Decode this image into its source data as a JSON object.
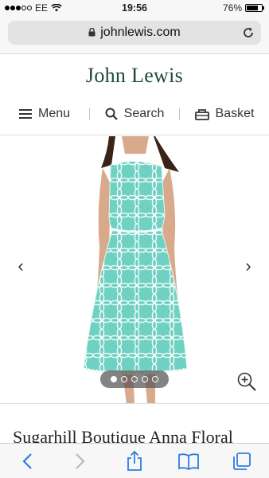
{
  "status_bar": {
    "carrier": "EE",
    "time": "19:56",
    "battery": "76%",
    "battery_level": 0.76,
    "signal_bars_filled": 3,
    "signal_bars_total": 5
  },
  "browser": {
    "url": "johnlewis.com"
  },
  "site": {
    "brand": "John Lewis",
    "brand_color": "#1e4a3a",
    "nav": {
      "menu_label": "Menu",
      "search_label": "Search",
      "basket_label": "Basket"
    }
  },
  "gallery": {
    "prev_icon": "‹",
    "next_icon": "›",
    "slide_count": 5,
    "active_slide": 1,
    "dress_color": "#6fd1c2"
  },
  "product": {
    "title": "Sugarhill Boutique Anna Floral"
  },
  "toolbar": {
    "accent": "#2f7de1"
  }
}
